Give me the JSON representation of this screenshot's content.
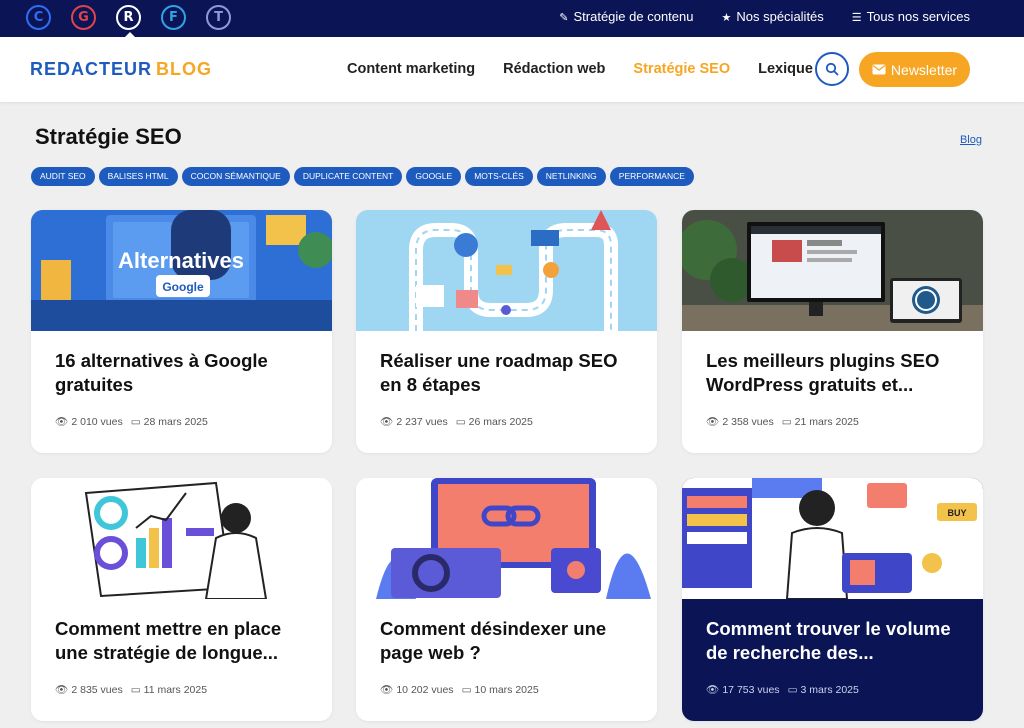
{
  "topbar": {
    "brands": [
      {
        "letter": "C",
        "color": "#2f6df6"
      },
      {
        "letter": "G",
        "color": "#e0434c"
      },
      {
        "letter": "R",
        "color": "#ffffff"
      },
      {
        "letter": "F",
        "color": "#31a3e4"
      },
      {
        "letter": "T",
        "color": "#8f9bd8"
      }
    ],
    "links": [
      {
        "icon": "pencil-icon",
        "label": "Stratégie de contenu"
      },
      {
        "icon": "star-icon",
        "label": "Nos spécialités"
      },
      {
        "icon": "menu-icon",
        "label": "Tous nos services"
      }
    ]
  },
  "header": {
    "logo_part1": "REDACTEUR",
    "logo_part2": "BLOG",
    "nav": [
      "Content marketing",
      "Rédaction web",
      "Stratégie SEO",
      "Lexique"
    ],
    "newsletter_label": "Newsletter"
  },
  "page": {
    "title": "Stratégie SEO",
    "breadcrumb": "Blog",
    "tags": [
      "AUDIT SEO",
      "BALISES HTML",
      "COCON SÉMANTIQUE",
      "DUPLICATE CONTENT",
      "GOOGLE",
      "MOTS-CLÉS",
      "NETLINKING",
      "PERFORMANCE"
    ]
  },
  "cards": [
    {
      "title": "16 alternatives à Google gratuites",
      "views": "2 010 vues",
      "date": "28 mars 2025",
      "image_text": "Alternatives",
      "image_badge": "Google"
    },
    {
      "title": "Réaliser une roadmap SEO en 8 étapes",
      "views": "2 237 vues",
      "date": "26 mars 2025"
    },
    {
      "title": "Les meilleurs plugins SEO WordPress gratuits et...",
      "views": "2 358 vues",
      "date": "21 mars 2025"
    },
    {
      "title": "Comment mettre en place une stratégie de longue...",
      "views": "2 835 vues",
      "date": "11 mars 2025"
    },
    {
      "title": "Comment désindexer une page web ?",
      "views": "10 202 vues",
      "date": "10 mars 2025"
    },
    {
      "title": "Comment trouver le volume de recherche des...",
      "views": "17 753 vues",
      "date": "3 mars 2025",
      "image_badge": "BUY"
    }
  ]
}
